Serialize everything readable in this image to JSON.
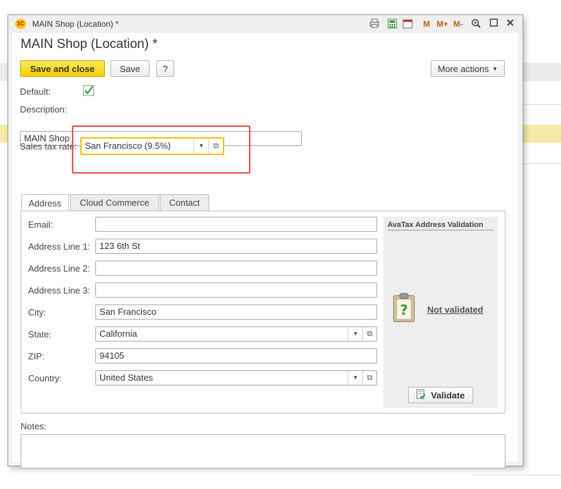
{
  "window": {
    "logo": "1С",
    "title": "MAIN Shop (Location) *",
    "toolbar_icons": [
      "print-icon",
      "calculator-icon",
      "calendar-icon",
      "m-icon",
      "m-plus-icon",
      "m-minus-icon",
      "zoom-icon",
      "maximize-icon",
      "close-icon"
    ],
    "toolbar_glyphs": {
      "m": "M",
      "m_plus": "M+",
      "m_minus": "M-",
      "calendar": "31"
    }
  },
  "form": {
    "title": "MAIN Shop (Location) *",
    "save_close_label": "Save and close",
    "save_label": "Save",
    "help_label": "?",
    "more_actions_label": "More actions",
    "default_label": "Default:",
    "default_checked": true,
    "description_label": "Description:",
    "description_value": "MAIN Shop",
    "sales_tax_label": "Sales tax rate:",
    "sales_tax_value": "San Francisco (9.5%)"
  },
  "tabs": [
    {
      "label": "Address",
      "active": true
    },
    {
      "label": "Cloud Commerce",
      "active": false
    },
    {
      "label": "Contact",
      "active": false
    }
  ],
  "address": {
    "email_label": "Email:",
    "email_value": "",
    "line1_label": "Address Line 1:",
    "line1_value": "123 6th St",
    "line2_label": "Address Line 2:",
    "line2_value": "",
    "line3_label": "Address Line 3:",
    "line3_value": "",
    "city_label": "City:",
    "city_value": "San Francisco",
    "state_label": "State:",
    "state_value": "California",
    "zip_label": "ZIP:",
    "zip_value": "94105",
    "country_label": "Country:",
    "country_value": "United States"
  },
  "avatax": {
    "title": "AvaTax Address Validation",
    "status": "Not validated",
    "validate_label": "Validate"
  },
  "notes": {
    "label": "Notes:",
    "value": ""
  },
  "colors": {
    "primary_button": "#f5d000",
    "highlight": "#e05555",
    "focus_border": "#f0c000",
    "check": "#2a9d3c"
  }
}
